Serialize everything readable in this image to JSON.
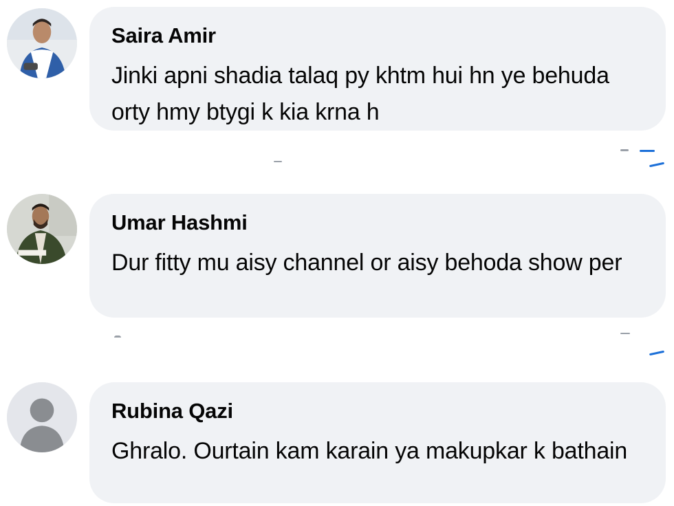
{
  "comments": [
    {
      "author": "Saira Amir",
      "text": "Jinki apni shadia talaq py khtm hui hn ye behuda orty hmy btygi k kia krna h",
      "avatar": "profile-photo"
    },
    {
      "author": "Umar Hashmi",
      "text": "Dur fitty mu aisy channel or aisy behoda show per",
      "avatar": "profile-photo"
    },
    {
      "author": "Rubina Qazi",
      "text": "Ghralo. Ourtain kam karain ya makupkar k bathain",
      "avatar": "default-avatar"
    }
  ],
  "colors": {
    "bubble": "#f0f2f5",
    "text": "#050505",
    "accent": "#1b6fd8"
  }
}
